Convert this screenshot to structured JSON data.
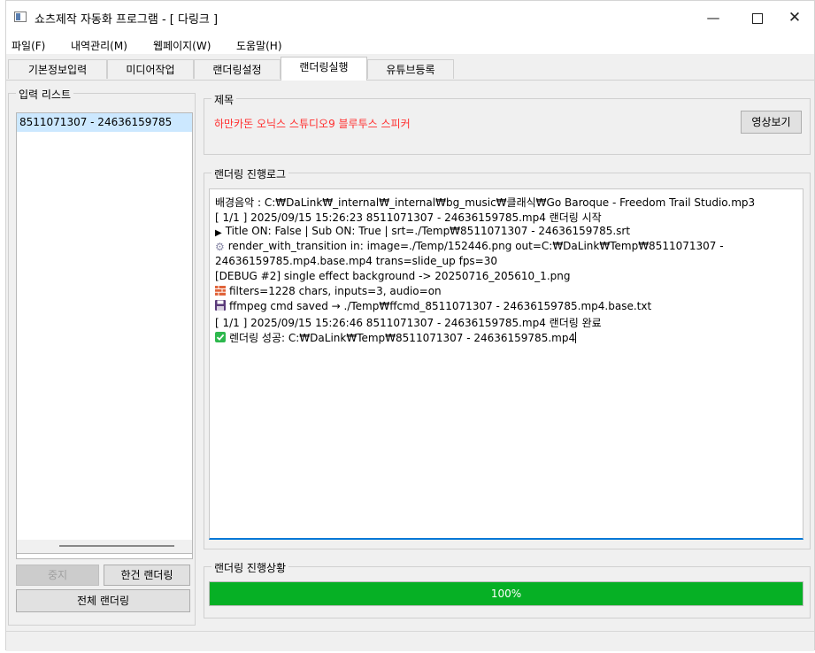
{
  "window": {
    "title": "쇼츠제작 자동화 프로그램 - [ 다링크 ]"
  },
  "menu": [
    "파일(F)",
    "내역관리(M)",
    "웹페이지(W)",
    "도움말(H)"
  ],
  "tabs": [
    {
      "label": "기본정보입력",
      "active": false
    },
    {
      "label": "미디어작업",
      "active": false
    },
    {
      "label": "랜더링설정",
      "active": false
    },
    {
      "label": "랜더링실행",
      "active": true
    },
    {
      "label": "유튜브등록",
      "active": false
    }
  ],
  "input_list": {
    "label": "입력 리스트",
    "items": [
      "8511071307 - 24636159785"
    ]
  },
  "buttons": {
    "stop": "중지",
    "render_single": "한건 랜더링",
    "render_all": "전체 랜더링",
    "preview": "영상보기"
  },
  "title_group": {
    "label": "제목",
    "value": "하만카돈 오닉스 스튜디오9 블루투스 스피커"
  },
  "log": {
    "label": "랜더링 진행로그",
    "lines": [
      {
        "icon": "",
        "text": "배경음악 : C:₩DaLink₩_internal₩_internal₩bg_music₩클래식₩Go Baroque - Freedom Trail Studio.mp3"
      },
      {
        "icon": "",
        "text": "[ 1/1 ] 2025/09/15 15:26:23 8511071307 - 24636159785.mp4 랜더링 시작"
      },
      {
        "icon": "play-triangle-icon",
        "text": "Title ON: False | Sub ON: True | srt=./Temp₩8511071307 - 24636159785.srt"
      },
      {
        "icon": "gear-icon",
        "text": "render_with_transition in: image=./Temp/152446.png out=C:₩DaLink₩Temp₩8511071307 -"
      },
      {
        "icon": "",
        "text": "24636159785.mp4.base.mp4 trans=slide_up fps=30"
      },
      {
        "icon": "",
        "text": "[DEBUG #2] single effect background -> 20250716_205610_1.png"
      },
      {
        "icon": "brick-icon",
        "text": "filters=1228 chars, inputs=3, audio=on"
      },
      {
        "icon": "floppy-disk-icon",
        "text": "ffmpeg cmd saved → ./Temp₩ffcmd_8511071307 - 24636159785.mp4.base.txt"
      },
      {
        "icon": "",
        "text": "[ 1/1 ] 2025/09/15 15:26:46 8511071307 - 24636159785.mp4 랜더링 완료"
      },
      {
        "icon": "check-mark-icon",
        "text": "렌더링 성공: C:₩DaLink₩Temp₩8511071307 - 24636159785.mp4"
      }
    ]
  },
  "progress": {
    "label": "랜더링 진행상황",
    "value": 1.0,
    "text": "100%"
  },
  "colors": {
    "title_red": "#ff3030",
    "progress_green": "#06b025",
    "selection": "#cce8ff",
    "focus_blue": "#0078d7"
  }
}
